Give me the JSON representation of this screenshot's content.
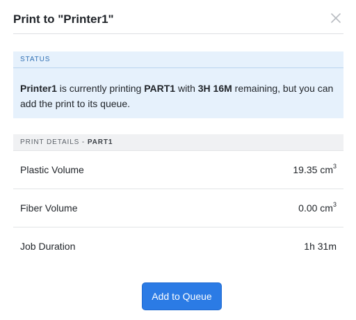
{
  "dialog": {
    "title": "Print to \"Printer1\"",
    "close_icon": "close-icon"
  },
  "status": {
    "heading": "STATUS",
    "printer": "Printer1",
    "text_1": " is currently printing ",
    "part": "PART1",
    "text_2": " with ",
    "remaining": "3H 16M",
    "text_3": " remaining, but you can add the print to its queue."
  },
  "details": {
    "heading": "PRINT DETAILS - ",
    "part": "PART1",
    "rows": [
      {
        "label": "Plastic Volume",
        "value": "19.35 cm",
        "unit_sup": "3"
      },
      {
        "label": "Fiber Volume",
        "value": "0.00 cm",
        "unit_sup": "3"
      },
      {
        "label": "Job Duration",
        "value": "1h 31m",
        "unit_sup": ""
      }
    ]
  },
  "actions": {
    "add_to_queue_label": "Add to Queue"
  },
  "colors": {
    "primary": "#2b7be5",
    "status_bg": "#e6f1fc",
    "status_heading": "#2f6fb3"
  }
}
